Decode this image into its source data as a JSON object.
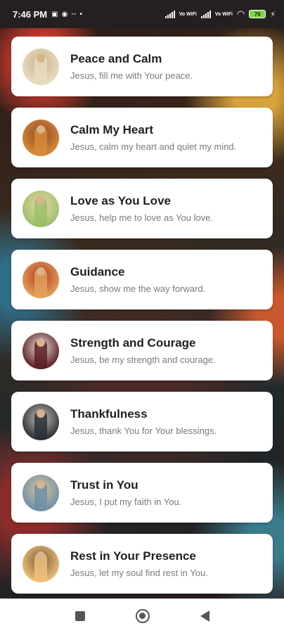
{
  "status_bar": {
    "time": "7:46 PM",
    "network_label_1": "Vo WiFi",
    "network_label_2": "Vo WiFi",
    "battery": "76"
  },
  "prayers": [
    {
      "title": "Peace and Calm",
      "subtitle": "Jesus, fill me with Your peace.",
      "icon": "jesus-portrait-icon",
      "colors": [
        "#e8dcc2",
        "#c9b48c"
      ]
    },
    {
      "title": "Calm My Heart",
      "subtitle": "Jesus, calm my heart and quiet my mind.",
      "icon": "jesus-portrait-icon",
      "colors": [
        "#d98a3a",
        "#8a4a22"
      ]
    },
    {
      "title": "Love as You Love",
      "subtitle": "Jesus, help me to love as You love.",
      "icon": "jesus-portrait-icon",
      "colors": [
        "#9bbf6a",
        "#e8d8a8"
      ]
    },
    {
      "title": "Guidance",
      "subtitle": "Jesus, show me the way forward.",
      "icon": "jesus-portrait-icon",
      "colors": [
        "#e2a15a",
        "#b23a22"
      ]
    },
    {
      "title": "Strength and Courage",
      "subtitle": "Jesus, be my strength and courage.",
      "icon": "jesus-portrait-icon",
      "colors": [
        "#5a1e22",
        "#e9e0d6"
      ]
    },
    {
      "title": "Thankfulness",
      "subtitle": "Jesus, thank You for Your blessings.",
      "icon": "jesus-portrait-icon",
      "colors": [
        "#2a2e36",
        "#c9c2b4"
      ]
    },
    {
      "title": "Trust in You",
      "subtitle": "Jesus, I put my faith in You.",
      "icon": "jesus-portrait-icon",
      "colors": [
        "#6f8fa6",
        "#d8c49a"
      ]
    },
    {
      "title": "Rest in Your Presence",
      "subtitle": "Jesus, let my soul find rest in You.",
      "icon": "jesus-portrait-icon",
      "colors": [
        "#f0c27a",
        "#7a5a3a"
      ]
    }
  ],
  "nav_bar": {
    "recents_icon": "square-icon",
    "home_icon": "circle-icon",
    "back_icon": "back-triangle-icon"
  }
}
